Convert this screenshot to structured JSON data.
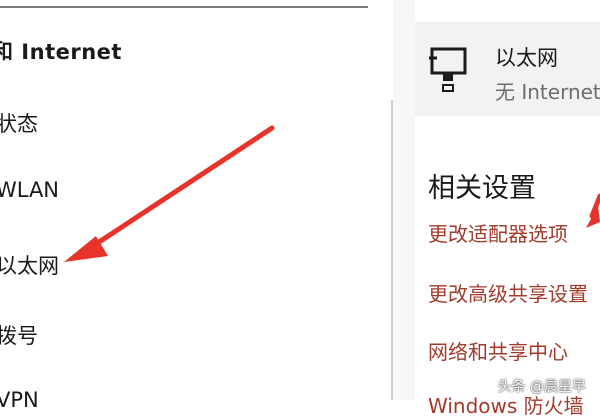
{
  "left": {
    "section_title": "和 Internet",
    "nav_items": [
      "状态",
      "WLAN",
      "以太网",
      "拨号",
      "VPN"
    ]
  },
  "card": {
    "icon": "ethernet-monitor-icon",
    "title": "以太网",
    "status": "无 Internet"
  },
  "related": {
    "title": "相关设置",
    "links": [
      "更改适配器选项",
      "更改高级共享设置",
      "网络和共享中心",
      "Windows 防火墙"
    ]
  },
  "watermark": "头条 @晨星早",
  "colors": {
    "link": "#a33b2c",
    "arrow": "#e8332a",
    "card_bg": "#f2f2f2"
  }
}
